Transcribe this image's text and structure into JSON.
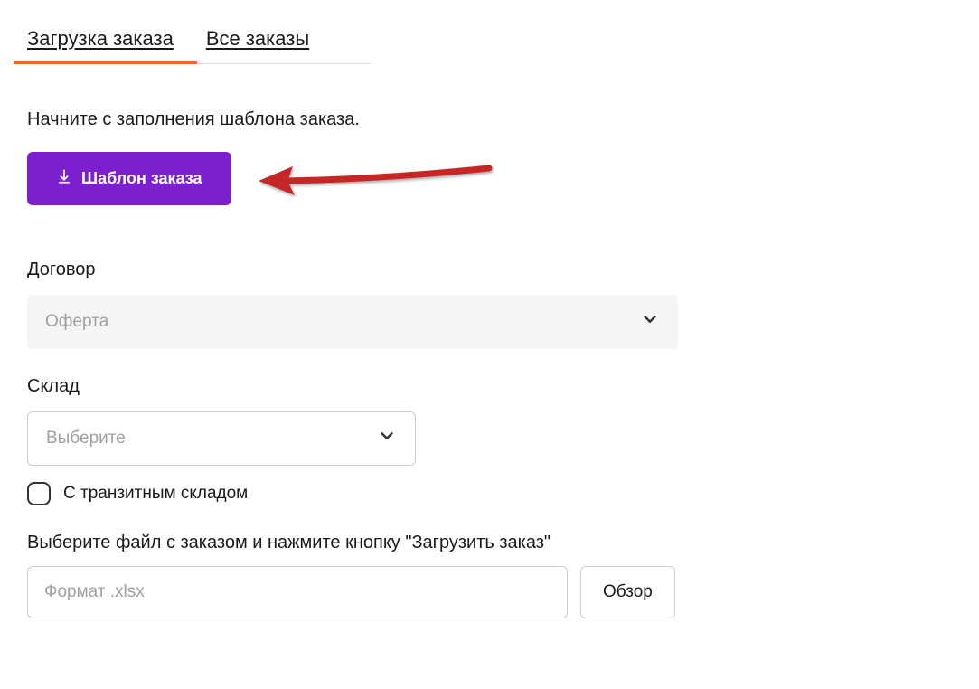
{
  "tabs": {
    "upload": "Загрузка заказа",
    "all": "Все заказы"
  },
  "instruction": "Начните с заполнения шаблона заказа.",
  "download_button": "Шаблон заказа",
  "form": {
    "contract_label": "Договор",
    "contract_value": "Оферта",
    "warehouse_label": "Склад",
    "warehouse_placeholder": "Выберите",
    "transit_checkbox_label": "С транзитным складом",
    "file_label": "Выберите файл с заказом и нажмите кнопку \"Загрузить заказ\"",
    "file_placeholder": "Формат .xlsx",
    "browse_button": "Обзор"
  }
}
